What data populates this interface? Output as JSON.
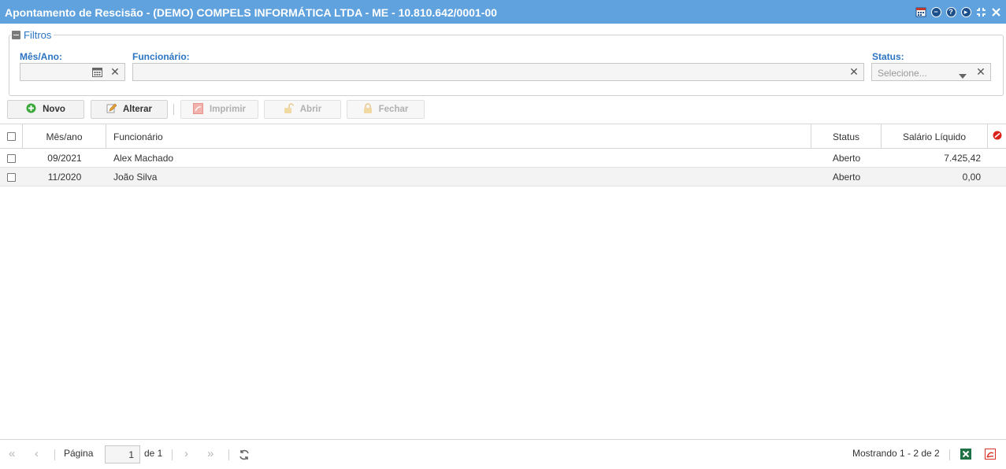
{
  "window": {
    "title": "Apontamento de Rescisão - (DEMO) COMPELS INFORMÁTICA LTDA - ME - 10.810.642/0001-00"
  },
  "filters": {
    "legend": "Filtros",
    "mes_ano_label": "Mês/Ano:",
    "mes_ano_value": "",
    "funcionario_label": "Funcionário:",
    "funcionario_value": "",
    "status_label": "Status:",
    "status_placeholder": "Selecione..."
  },
  "toolbar": {
    "novo": "Novo",
    "alterar": "Alterar",
    "imprimir": "Imprimir",
    "abrir": "Abrir",
    "fechar": "Fechar"
  },
  "grid": {
    "columns": [
      "Mês/ano",
      "Funcionário",
      "Status",
      "Salário Líquido"
    ],
    "rows": [
      {
        "mes_ano": "09/2021",
        "funcionario": "Alex Machado",
        "status": "Aberto",
        "salario": "7.425,42"
      },
      {
        "mes_ano": "11/2020",
        "funcionario": "João Silva",
        "status": "Aberto",
        "salario": "0,00"
      }
    ]
  },
  "pager": {
    "page_label": "Página",
    "page_value": "1",
    "of_label": "de 1",
    "showing": "Mostrando 1 - 2 de 2"
  },
  "colors": {
    "titlebar": "#5fa2de",
    "label_blue": "#2a74c2",
    "novo_green": "#3aa83a",
    "excel_green": "#1e7145",
    "pdf_red": "#d9342b"
  }
}
